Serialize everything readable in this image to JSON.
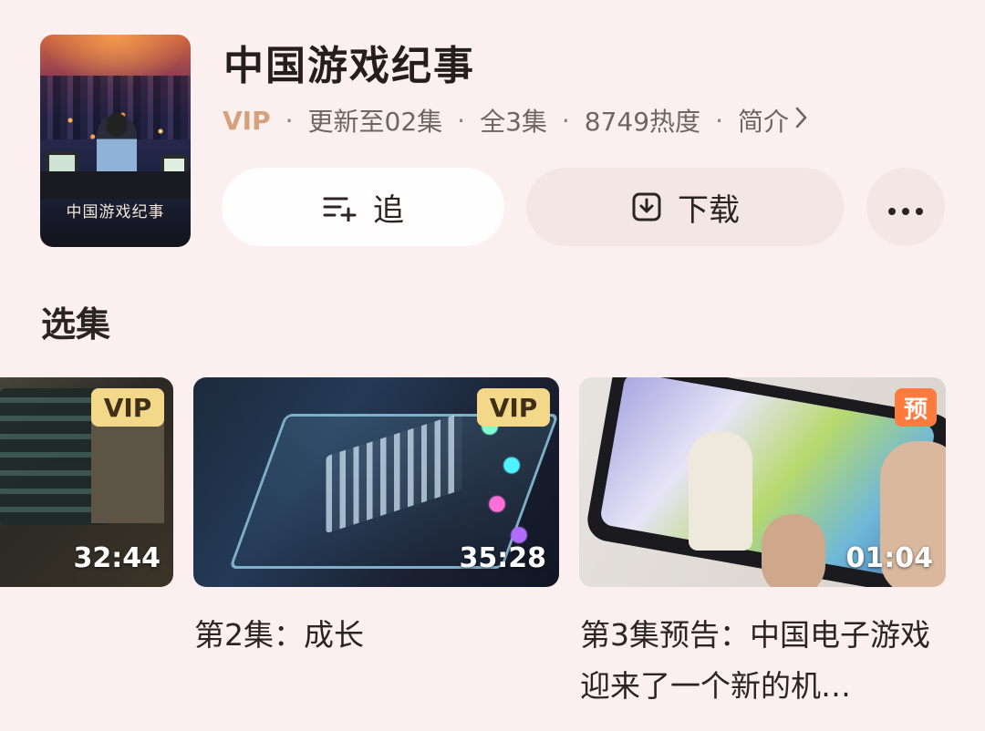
{
  "show": {
    "title": "中国游戏纪事",
    "poster_title": "中国游戏纪事"
  },
  "meta": {
    "vip": "VIP",
    "update": "更新至02集",
    "total": "全3集",
    "heat": "8749热度",
    "intro": "简介"
  },
  "actions": {
    "follow_label": "追",
    "download_label": "下载"
  },
  "section": {
    "episodes_title": "选集"
  },
  "episodes": [
    {
      "badge": "VIP",
      "duration": "32:44",
      "title": ""
    },
    {
      "badge": "VIP",
      "duration": "35:28",
      "title": "第2集：成长"
    },
    {
      "badge": "预",
      "duration": "01:04",
      "title": "第3集预告：中国电子游戏迎来了一个新的机…"
    }
  ],
  "colors": {
    "background": "#fbf0ef",
    "vip_text": "#d4a17a",
    "vip_badge": "#f4d88a",
    "preview_badge": "#ff7a3d"
  }
}
